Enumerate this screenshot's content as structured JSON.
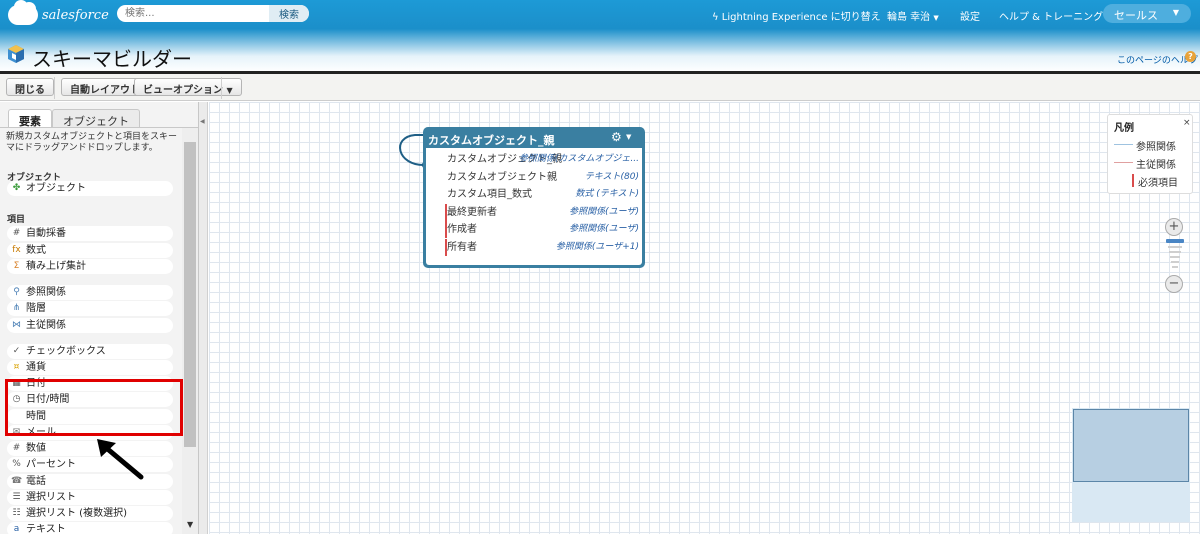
{
  "header": {
    "logo_text": "salesforce",
    "search_placeholder": "検索...",
    "search_button": "検索",
    "lightning_link": "Lightning Experience に切り替え",
    "user_menu": "輪島 幸治",
    "settings": "設定",
    "help_training": "ヘルプ & トレーニング",
    "app_switcher": "セールス"
  },
  "page": {
    "title": "スキーマビルダー",
    "help_link": "このページのヘルプ"
  },
  "toolbar": {
    "close": "閉じる",
    "auto_layout": "自動レイアウト",
    "view_options": "ビューオプション"
  },
  "panel": {
    "tabs": [
      "要素",
      "オブジェクト"
    ],
    "instructions": "新規カスタムオブジェクトと項目をスキーマにドラッグアンドドロップします。",
    "object_section": "オブジェクト",
    "object_item": "オブジェクト",
    "field_section": "項目",
    "fields": [
      {
        "label": "自動採番",
        "icon": "#"
      },
      {
        "label": "数式",
        "icon": "fx"
      },
      {
        "label": "積み上げ集計",
        "icon": "Σ"
      },
      {
        "label": "参照関係",
        "icon": "⚲"
      },
      {
        "label": "階層",
        "icon": "⋔"
      },
      {
        "label": "主従関係",
        "icon": "⋈"
      },
      {
        "label": "チェックボックス",
        "icon": "✓"
      },
      {
        "label": "通貨",
        "icon": "¤"
      },
      {
        "label": "日付",
        "icon": "▦"
      },
      {
        "label": "日付/時間",
        "icon": "◷"
      },
      {
        "label": "時間",
        "icon": ""
      },
      {
        "label": "メール",
        "icon": "✉"
      },
      {
        "label": "数値",
        "icon": "#"
      },
      {
        "label": "パーセント",
        "icon": "%"
      },
      {
        "label": "電話",
        "icon": "☎"
      },
      {
        "label": "選択リスト",
        "icon": "☰"
      },
      {
        "label": "選択リスト (複数選択)",
        "icon": "☷"
      },
      {
        "label": "テキスト",
        "icon": "a"
      }
    ]
  },
  "entity": {
    "title": "カスタムオブジェクト_親",
    "fields": [
      {
        "name": "カスタムオブジェクト_親",
        "type": "参照関係(カスタムオブジェ...",
        "required": false
      },
      {
        "name": "カスタムオブジェクト親",
        "type": "テキスト(80)",
        "required": false
      },
      {
        "name": "カスタム項目_数式",
        "type": "数式 (テキスト)",
        "required": false
      },
      {
        "name": "最終更新者",
        "type": "参照関係(ユーザ)",
        "required": true
      },
      {
        "name": "作成者",
        "type": "参照関係(ユーザ)",
        "required": true
      },
      {
        "name": "所有者",
        "type": "参照関係(ユーザ+1)",
        "required": true
      }
    ]
  },
  "legend": {
    "title": "凡例",
    "close": "×",
    "items": [
      {
        "label": "参照関係",
        "color": "#9fc3e0"
      },
      {
        "label": "主従関係",
        "color": "#e0a0a0"
      },
      {
        "label": "必須項目",
        "color": "#d94c4c"
      }
    ]
  },
  "zoom": {
    "in": "+",
    "out": "−"
  },
  "colors": {
    "accent": "#1b8fca",
    "entity_header": "#3a7fa1",
    "highlight": "#e00000"
  }
}
